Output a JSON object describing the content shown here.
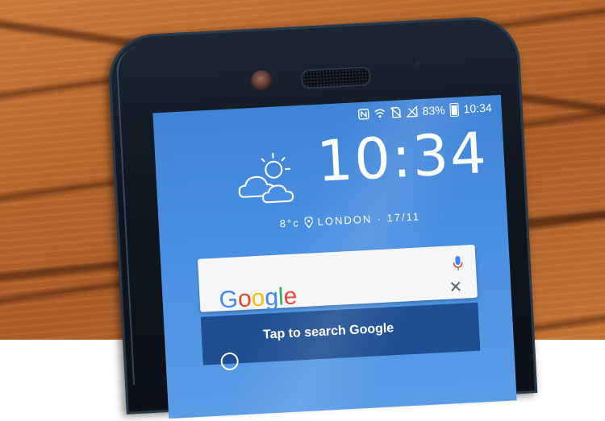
{
  "status_bar": {
    "battery_percent": "83%",
    "time": "10:34",
    "icons": [
      "nfc-icon",
      "wifi-icon",
      "no-sim-icon",
      "signal-icon",
      "battery-icon"
    ]
  },
  "clock_widget": {
    "time": "10:34",
    "temperature": "8°c",
    "location": "LONDON",
    "date": "17/11",
    "separator": "·",
    "weather_icon": "partly-cloudy-icon"
  },
  "search_widget": {
    "logo_text": [
      "G",
      "o",
      "o",
      "g",
      "l",
      "e"
    ],
    "logo_colors": [
      "#4285F4",
      "#EA4335",
      "#FBBC05",
      "#4285F4",
      "#34A853",
      "#EA4335"
    ],
    "hint": "Tap to search Google",
    "mic_color": "#4285F4"
  }
}
